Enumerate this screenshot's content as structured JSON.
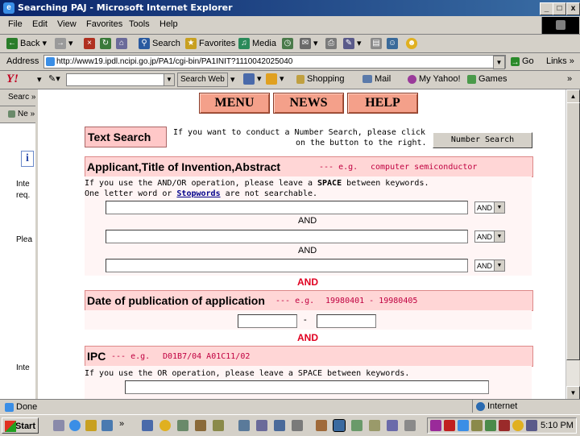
{
  "window": {
    "title": "Searching PAJ - Microsoft Internet Explorer",
    "controls": [
      "_",
      "□",
      "x"
    ]
  },
  "menu": [
    "File",
    "Edit",
    "View",
    "Favorites",
    "Tools",
    "Help"
  ],
  "toolbar": {
    "back": "Back",
    "search": "Search",
    "favorites": "Favorites",
    "media": "Media"
  },
  "address": {
    "label": "Address",
    "url": "http://www19.ipdl.ncipi.go.jp/PA1/cgi-bin/PA1INIT?1110042025040",
    "go": "Go",
    "links": "Links"
  },
  "yahoo": {
    "logo": "Y!",
    "search_button": "Search Web",
    "shopping": "Shopping",
    "mail": "Mail",
    "my_yahoo": "My Yahoo!",
    "games": "Games"
  },
  "leftpane": {
    "tab1": "Searc",
    "tab2": "Ne",
    "info_icon": "i",
    "text1": "Inte",
    "text2": "req.",
    "text3": "Plea",
    "text4": "Inte"
  },
  "nav": {
    "menu": "MENU",
    "news": "NEWS",
    "help": "HELP"
  },
  "text_search": {
    "label": "Text Search",
    "hint_line1": "If you want to conduct a Number Search, please click",
    "hint_line2": "on the button to the right.",
    "number_search_button": "Number Search"
  },
  "applicant": {
    "label": "Applicant,Title of Invention,Abstract",
    "example_prefix": "--- e.g.",
    "example": "computer semiconductor",
    "help1_a": "If you use the AND/OR operation, please leave a",
    "help1_b": "SPACE",
    "help1_c": "between keywords.",
    "help2_a": "One letter word or",
    "help2_link": "Stopwords",
    "help2_b": "are not searchable.",
    "operator": "AND",
    "between": "AND"
  },
  "red_and": "AND",
  "date": {
    "label": "Date of publication of application",
    "example_prefix": "--- e.g.",
    "example": "19980401 - 19980405",
    "dash": "-"
  },
  "ipc": {
    "label": "IPC",
    "example_prefix": "--- e.g.",
    "example": "D01B7/04 A01C11/02",
    "help": "If you use the OR operation, please leave a SPACE between keywords."
  },
  "status": {
    "text": "Done",
    "zone": "Internet"
  },
  "taskbar": {
    "start": "Start",
    "clock": "5:10 PM"
  },
  "colors": {
    "title_bar": "#0a246a",
    "nav_button": "#f4a08a",
    "section_bg": "#ffd6d6",
    "red_and": "#e00020"
  }
}
